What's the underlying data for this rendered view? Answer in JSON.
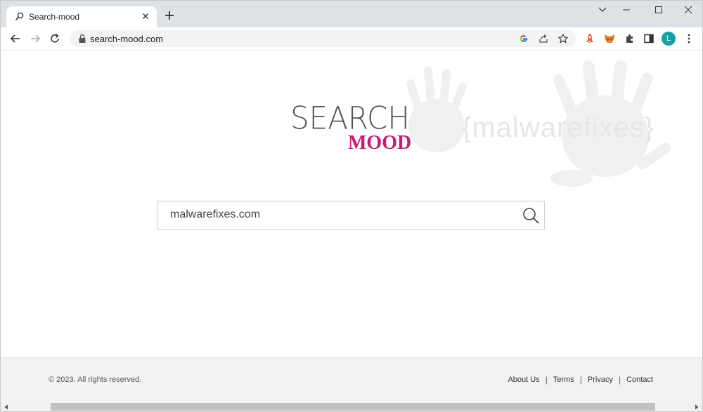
{
  "browser": {
    "tab": {
      "title": "Search-mood"
    },
    "address_bar": {
      "url": "search-mood.com"
    },
    "profile_initial": "L",
    "colors": {
      "profile_bg": "#1a9fa4",
      "tabstrip_bg": "#dee1e6"
    }
  },
  "page": {
    "logo": {
      "top": "SEARCH",
      "bottom": "MOOD"
    },
    "watermark": "{malwarefixes}",
    "search": {
      "value": "malwarefixes.com"
    },
    "footer": {
      "copyright": "© 2023. All rights reserved.",
      "links": [
        "About Us",
        "Terms",
        "Privacy",
        "Contact"
      ],
      "separator": "|"
    },
    "colors": {
      "brand_pink": "#c9197d",
      "logo_gray": "#555555"
    }
  },
  "icons": {
    "tab": "search-icon",
    "close": "close-icon",
    "new_tab": "plus-icon",
    "back": "back-arrow-icon",
    "forward": "forward-arrow-icon",
    "reload": "reload-icon",
    "lock": "lock-icon",
    "google": "google-icon",
    "share": "share-icon",
    "bookmark": "star-icon",
    "extension1": "rocket-extension-icon",
    "extension2": "fox-extension-icon",
    "extensions": "puzzle-icon",
    "sidepanel": "side-panel-icon",
    "menu": "kebab-menu-icon",
    "search_button": "magnifier-icon"
  }
}
